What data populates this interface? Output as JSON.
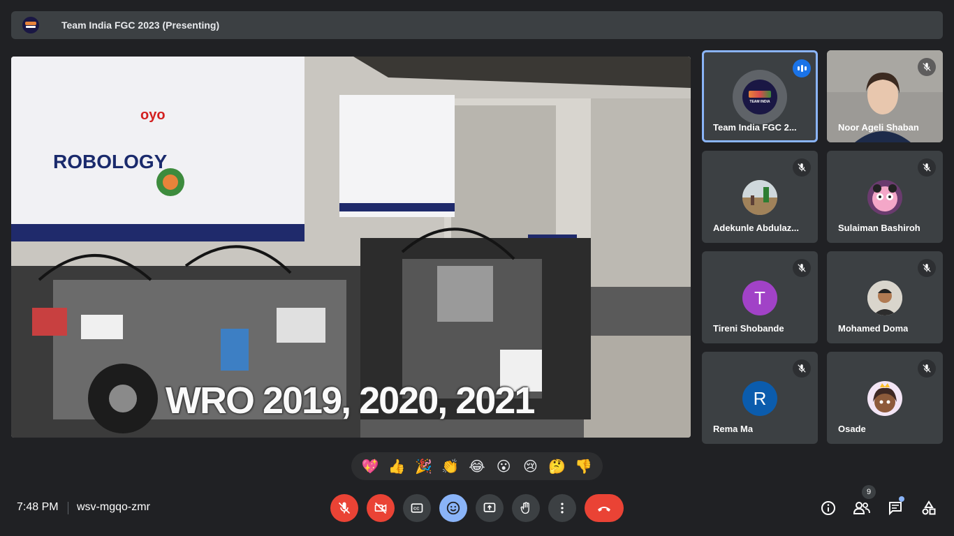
{
  "top_bar": {
    "title": "Team India FGC 2023 (Presenting)"
  },
  "presentation": {
    "overlay_text": "WRO 2019, 2020, 2021"
  },
  "participants": [
    {
      "name": "Team India FGC 2...",
      "status": "speaking",
      "avatar": "team-logo"
    },
    {
      "name": "Noor Ageli Shaban",
      "status": "muted",
      "avatar": "video"
    },
    {
      "name": "Adekunle Abdulaz...",
      "status": "muted",
      "avatar": "photo"
    },
    {
      "name": "Sulaiman Bashiroh",
      "status": "muted",
      "avatar": "photo"
    },
    {
      "name": "Tireni Shobande",
      "status": "muted",
      "avatar": "letter",
      "initial": "T",
      "color": "#a142c7"
    },
    {
      "name": "Mohamed Doma",
      "status": "muted",
      "avatar": "photo"
    },
    {
      "name": "Rema Ma",
      "status": "muted",
      "avatar": "letter",
      "initial": "R",
      "color": "#0b5cad"
    },
    {
      "name": "Osade",
      "status": "muted",
      "avatar": "photo"
    }
  ],
  "reactions": [
    "💖",
    "👍",
    "🎉",
    "👏",
    "😂",
    "😮",
    "😢",
    "🤔",
    "👎"
  ],
  "bottom_bar": {
    "time": "7:48 PM",
    "meeting_code": "wsv-mgqo-zmr",
    "participant_count": "9"
  },
  "colors": {
    "accent": "#8ab4f8",
    "danger": "#ea4335",
    "surface": "#3c4043",
    "background": "#202124"
  }
}
